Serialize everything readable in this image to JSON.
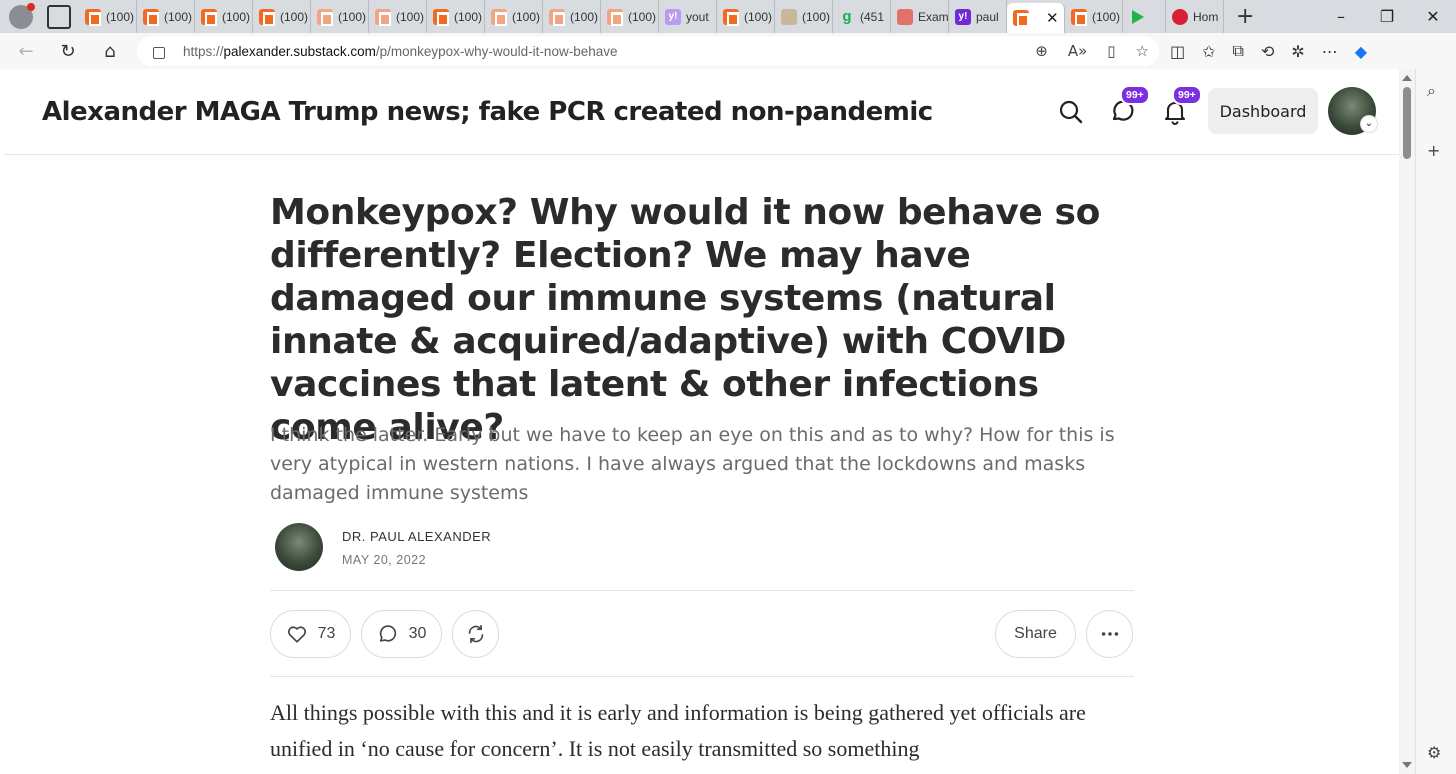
{
  "browser": {
    "tabs": [
      {
        "label": "(100)",
        "icon": "substack-icon",
        "style": "ss"
      },
      {
        "label": "(100)",
        "icon": "substack-icon",
        "style": "ss"
      },
      {
        "label": "(100)",
        "icon": "substack-icon",
        "style": "ss"
      },
      {
        "label": "(100)",
        "icon": "substack-icon",
        "style": "ss"
      },
      {
        "label": "(100)",
        "icon": "substack-icon",
        "style": "ss faded"
      },
      {
        "label": "(100)",
        "icon": "substack-icon",
        "style": "ss faded"
      },
      {
        "label": "(100)",
        "icon": "substack-icon",
        "style": "ss"
      },
      {
        "label": "(100)",
        "icon": "substack-icon",
        "style": "ss faded"
      },
      {
        "label": "(100)",
        "icon": "substack-icon",
        "style": "ss faded"
      },
      {
        "label": "(100)",
        "icon": "substack-icon",
        "style": "ss faded"
      },
      {
        "label": "yout",
        "icon": "yahoo-icon",
        "style": "yh light"
      },
      {
        "label": "(100)",
        "icon": "substack-icon",
        "style": "ss"
      },
      {
        "label": "(100)",
        "icon": "image-icon",
        "style": "img"
      },
      {
        "label": "(451",
        "icon": "g-icon",
        "style": "gr"
      },
      {
        "label": "Exam",
        "icon": "youtube-icon",
        "style": "yt"
      },
      {
        "label": "paul",
        "icon": "yahoo-icon",
        "style": "yh"
      },
      {
        "label": "",
        "icon": "substack-icon",
        "style": "ss",
        "active": true
      },
      {
        "label": "(100)",
        "icon": "substack-icon",
        "style": "ss"
      },
      {
        "label": "",
        "icon": "play-icon",
        "style": "play"
      },
      {
        "label": "Hom",
        "icon": "red-icon",
        "style": "red"
      }
    ],
    "url_prefix": "https://",
    "url_host": "palexander.substack.com",
    "url_path": "/p/monkeypox-why-would-it-now-behave"
  },
  "header": {
    "publication_title": "Alexander MAGA Trump news; fake PCR created non-pandemic",
    "chat_badge": "99+",
    "notifications_badge": "99+",
    "dashboard_label": "Dashboard"
  },
  "article": {
    "title": "Monkeypox? Why would it now behave so differently? Election? We may have damaged our immune systems (natural innate & acquired/adaptive) with COVID vaccines that latent & other infections come alive?",
    "subtitle": "I think the latter. Early but we have to keep an eye on this and as to why? How for this is very atypical in western nations. I have always argued that the lockdowns and masks damaged immune systems",
    "author": "DR. PAUL ALEXANDER",
    "date": "MAY 20, 2022",
    "likes": "73",
    "comments": "30",
    "share_label": "Share",
    "body": "All things possible with this and it is early and information is being gathered yet officials are unified in ‘no cause for concern’. It is not easily transmitted so something"
  }
}
